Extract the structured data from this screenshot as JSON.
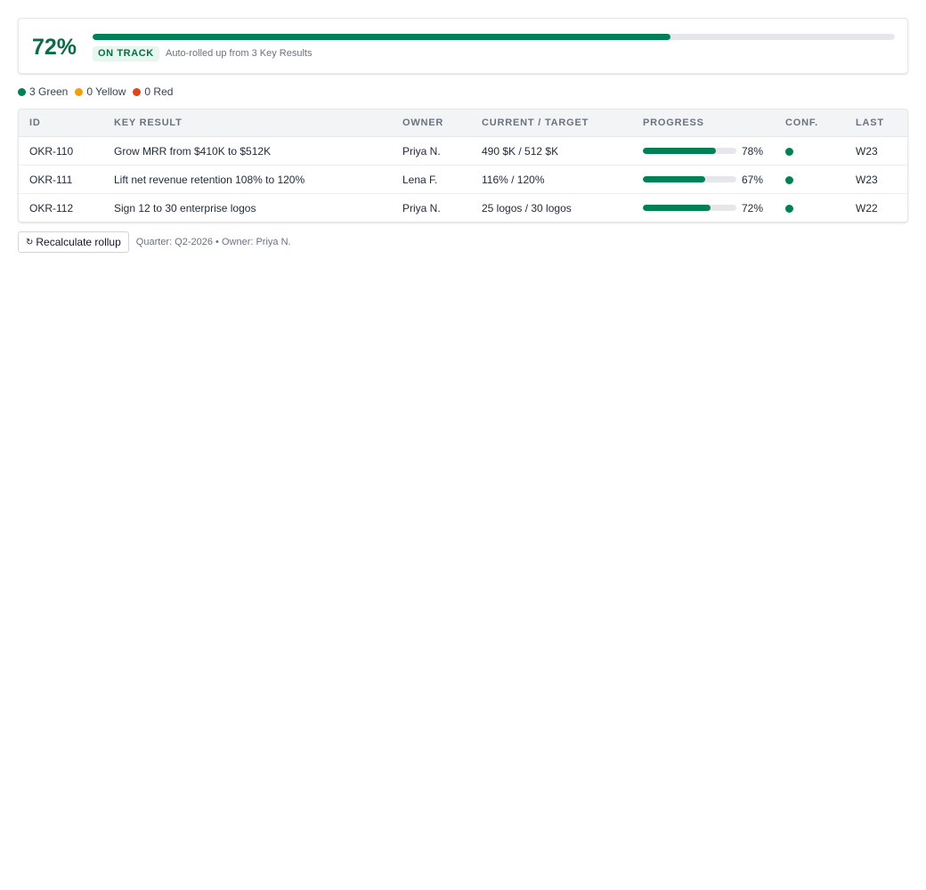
{
  "summary": {
    "overall_pct_label": "72%",
    "overall_progress": 0.72,
    "status": "ON TRACK",
    "rollup_note": "Auto-rolled up from 3 Key Results"
  },
  "legend": [
    {
      "label": "3 Green",
      "color": "#008055"
    },
    {
      "label": "0 Yellow",
      "color": "#f59e0b"
    },
    {
      "label": "0 Red",
      "color": "#e0441c"
    }
  ],
  "table": {
    "headers": [
      "ID",
      "KEY RESULT",
      "OWNER",
      "CURRENT / TARGET",
      "PROGRESS",
      "CONF.",
      "LAST"
    ],
    "rows": [
      {
        "id": "OKR-110",
        "key_result": "Grow MRR from $410K to $512K",
        "owner": "Priya N.",
        "current_target": "490 $K / 512 $K",
        "progress": 0.78,
        "progress_label": "78%",
        "confidence": "green",
        "last": "W23"
      },
      {
        "id": "OKR-111",
        "key_result": "Lift net revenue retention 108% to 120%",
        "owner": "Lena F.",
        "current_target": "116% / 120%",
        "progress": 0.67,
        "progress_label": "67%",
        "confidence": "green",
        "last": "W23"
      },
      {
        "id": "OKR-112",
        "key_result": "Sign 12 to 30 enterprise logos",
        "owner": "Priya N.",
        "current_target": "25 logos / 30 logos",
        "progress": 0.72,
        "progress_label": "72%",
        "confidence": "green",
        "last": "W22"
      }
    ]
  },
  "footer": {
    "recalc_icon": "↻",
    "recalc_label": "Recalculate rollup",
    "meta": "Quarter: Q2-2026 • Owner: Priya N."
  },
  "colors": {
    "accent": "#008055",
    "accent_text": "#0b6b45",
    "badge_bg": "#e7f6ee"
  }
}
